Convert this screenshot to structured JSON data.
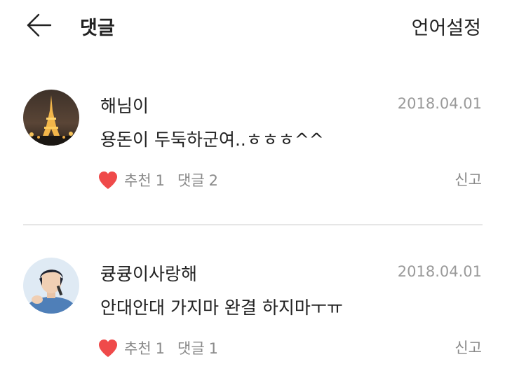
{
  "header": {
    "back_icon": "arrow-left-icon",
    "title": "댓글",
    "language_settings": "언어설정"
  },
  "comments": [
    {
      "author": "해님이",
      "date": "2018.04.01",
      "text": "용돈이 두둑하군여..ㅎㅎㅎ^^",
      "like_label": "추천",
      "like_count": "1",
      "reply_label": "댓글",
      "reply_count": "2",
      "report": "신고",
      "avatar": "eiffel-tower-night-photo"
    },
    {
      "author": "큥큥이사랑해",
      "date": "2018.04.01",
      "text": "안대안대 가지마 완결 하지마ㅜㅠ",
      "like_label": "추천",
      "like_count": "1",
      "reply_label": "댓글",
      "reply_count": "1",
      "report": "신고",
      "avatar": "person-with-microphone-photo"
    }
  ],
  "colors": {
    "heart": "#ef4a4a",
    "meta_text": "#8a8a8a",
    "date_text": "#9a9a9a",
    "divider": "#e6e6e6"
  }
}
